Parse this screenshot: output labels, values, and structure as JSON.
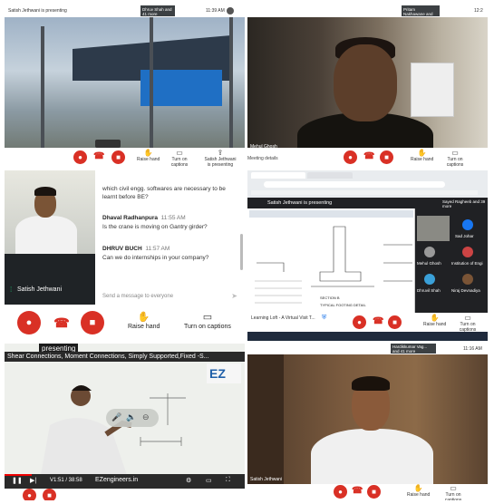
{
  "tile1": {
    "presenting": "Satish Jethwani is presenting",
    "top_badge": "Dhruv Shah and 41 more",
    "top_time": "11:39 AM"
  },
  "tile2": {
    "top_badge": "Pritam Nakhawane and 41 more",
    "top_time": "12:2",
    "bottom_label": "Meeting details",
    "corner_name": "Mehul Ghosh"
  },
  "small_toolbar": {
    "raise_hand": "Raise hand",
    "captions": "Turn on captions",
    "presenting": "Satish Jethwani is presenting"
  },
  "chat": {
    "prev_message": "which civil engg. softwares are necessary to be learnt before BE?",
    "messages": [
      {
        "author": "Dhaval Radhanpura",
        "time": "11:55 AM",
        "text": "Is the crane is moving on Gantry girder?"
      },
      {
        "author": "DHRUV BUCH",
        "time": "11:57 AM",
        "text": "Can we do internships in your company?"
      }
    ],
    "input_placeholder": "Send a message to everyone",
    "self_name": "Satish Jethwani",
    "raise_hand": "Raise hand",
    "captions": "Turn on captions"
  },
  "tile4": {
    "presenting": "Satish Jethwani is presenting",
    "badge": "Sayed Ragheeb and 39 more",
    "section_label": "SECTION B",
    "sheet_title": "TYPICAL FOOTING DETAIL",
    "side_names": [
      "Sad Johar",
      "Mehul Ghosh",
      "Institution of Engi",
      "Dhruvil Shah",
      "Niraj Devnadiya"
    ],
    "meeting_label": "Learning Loft - A Virtual Visit T..."
  },
  "tile5": {
    "presenting": "presenting",
    "subtitle": "Shear Connections, Moment Connections, Simply Supported,Fixed -S...",
    "brand": "EZengineers.in",
    "time": "V1:51 / 38:58"
  },
  "tile6": {
    "badge": "Hardikkumar Vag... and 41 more",
    "time": "11:16 AM",
    "corner_name": "Satish Jethwani"
  }
}
